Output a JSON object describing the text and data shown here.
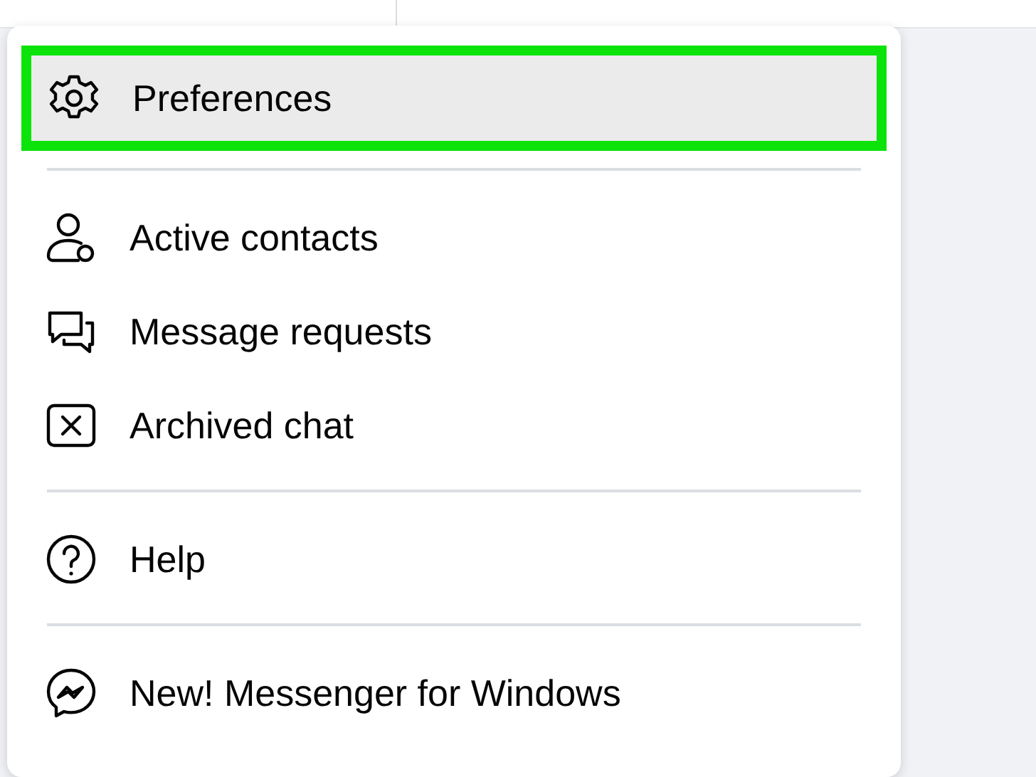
{
  "menu": {
    "sections": [
      {
        "items": [
          {
            "label": "Preferences",
            "kind": "gear",
            "selected": true
          }
        ]
      },
      {
        "items": [
          {
            "label": "Active contacts",
            "kind": "person",
            "selected": false
          },
          {
            "label": "Message requests",
            "kind": "bubbles",
            "selected": false
          },
          {
            "label": "Archived chat",
            "kind": "archive",
            "selected": false
          }
        ]
      },
      {
        "items": [
          {
            "label": "Help",
            "kind": "help",
            "selected": false
          }
        ]
      },
      {
        "items": [
          {
            "label": "New! Messenger for Windows",
            "kind": "messenger",
            "selected": false
          }
        ]
      }
    ]
  }
}
